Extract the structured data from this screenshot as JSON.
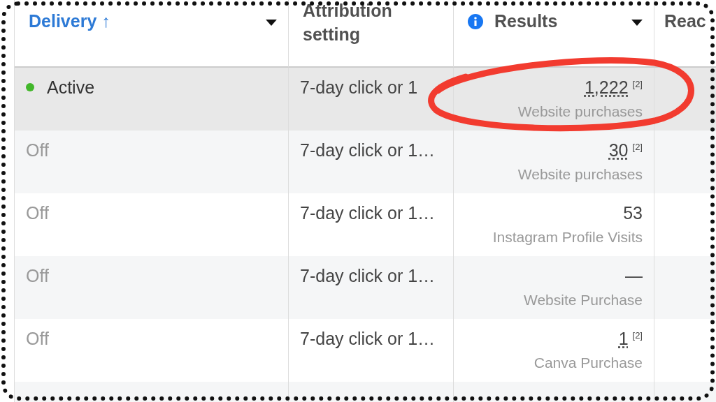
{
  "columns": [
    {
      "label": "Delivery ↑",
      "sorted": true,
      "caret": true,
      "info": false
    },
    {
      "label": "Attribution setting",
      "sorted": false,
      "caret": false,
      "info": false
    },
    {
      "label": "Results",
      "sorted": false,
      "caret": true,
      "info": true
    },
    {
      "label": "Reac",
      "sorted": false,
      "caret": false,
      "info": false
    }
  ],
  "rows": [
    {
      "selected": true,
      "status": "Active",
      "kind": "active",
      "attribution": "7-day click or 1",
      "result": "1,222",
      "underlined": true,
      "footnote": "[2]",
      "result_label": "Website purchases"
    },
    {
      "selected": false,
      "status": "Off",
      "kind": "off",
      "attribution": "7-day click or 1…",
      "result": "30",
      "underlined": true,
      "footnote": "[2]",
      "result_label": "Website purchases"
    },
    {
      "selected": false,
      "status": "Off",
      "kind": "off",
      "attribution": "7-day click or 1…",
      "result": "53",
      "underlined": false,
      "result_label": "Instagram Profile Visits"
    },
    {
      "selected": false,
      "status": "Off",
      "kind": "off",
      "attribution": "7-day click or 1…",
      "result": "—",
      "underlined": false,
      "result_label": "Website Purchase"
    },
    {
      "selected": false,
      "status": "Off",
      "kind": "off",
      "attribution": "7-day click or 1…",
      "result": "1",
      "underlined": true,
      "footnote": "[2]",
      "result_label": "Canva Purchase"
    }
  ]
}
